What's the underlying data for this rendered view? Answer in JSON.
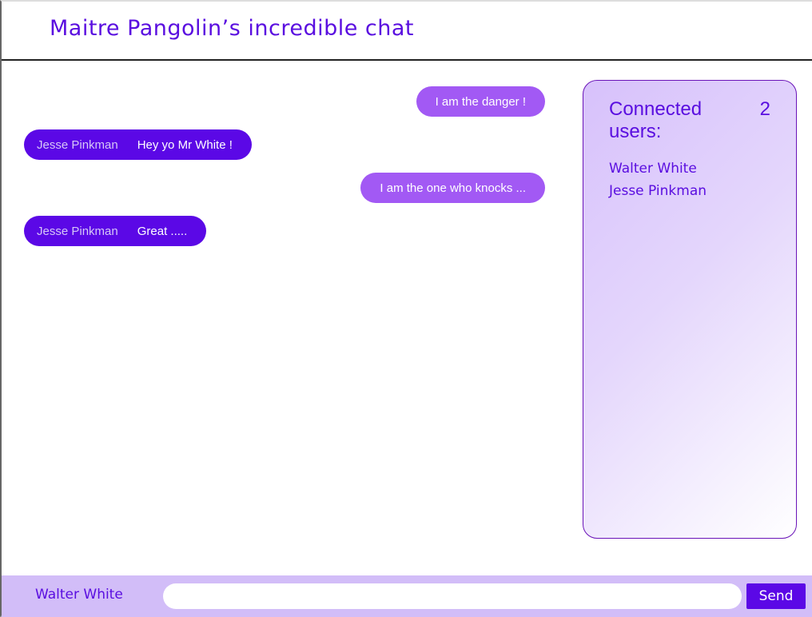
{
  "header": {
    "title": "Maitre Pangolin’s incredible chat"
  },
  "messages": [
    {
      "self": true,
      "text": "I am the danger !"
    },
    {
      "self": false,
      "author": "Jesse Pinkman",
      "text": "Hey yo Mr White !"
    },
    {
      "self": true,
      "text": "I am the one who knocks ..."
    },
    {
      "self": false,
      "author": "Jesse Pinkman",
      "text": "Great ....."
    }
  ],
  "users_panel": {
    "title_label": "Connected users:",
    "count": "2",
    "users": [
      "Walter White",
      "Jesse Pinkman"
    ]
  },
  "footer": {
    "current_user": "Walter White",
    "input_value": "",
    "input_placeholder": "",
    "send_label": "Send"
  },
  "colors": {
    "accent": "#5b08e6",
    "self_bubble": "#a259f4",
    "footer_bg": "#d2bdf8"
  }
}
